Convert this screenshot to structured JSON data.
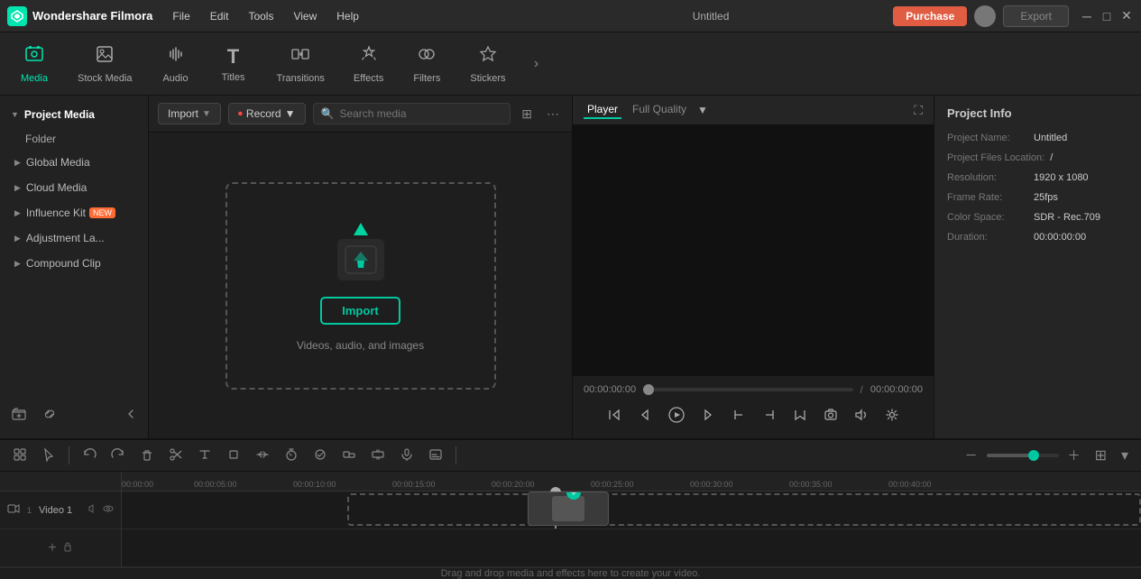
{
  "app": {
    "name": "Wondershare Filmora",
    "title": "Untitled"
  },
  "titlebar": {
    "menu_items": [
      "File",
      "Edit",
      "Tools",
      "View",
      "Help"
    ],
    "purchase_label": "Purchase",
    "export_label": "Export"
  },
  "toolbar": {
    "items": [
      {
        "id": "media",
        "label": "Media",
        "icon": "🎬"
      },
      {
        "id": "stock-media",
        "label": "Stock Media",
        "icon": "🎞"
      },
      {
        "id": "audio",
        "label": "Audio",
        "icon": "🎵"
      },
      {
        "id": "titles",
        "label": "Titles",
        "icon": "T"
      },
      {
        "id": "transitions",
        "label": "Transitions",
        "icon": "↔"
      },
      {
        "id": "effects",
        "label": "Effects",
        "icon": "✨"
      },
      {
        "id": "filters",
        "label": "Filters",
        "icon": "🎨"
      },
      {
        "id": "stickers",
        "label": "Stickers",
        "icon": "⭐"
      }
    ]
  },
  "sidebar": {
    "sections": [
      {
        "id": "project-media",
        "label": "Project Media",
        "active": true
      },
      {
        "id": "folder",
        "label": "Folder",
        "indent": true
      },
      {
        "id": "global-media",
        "label": "Global Media"
      },
      {
        "id": "cloud-media",
        "label": "Cloud Media"
      },
      {
        "id": "influence-kit",
        "label": "Influence Kit",
        "badge": "NEW"
      },
      {
        "id": "adjustment-la",
        "label": "Adjustment La..."
      },
      {
        "id": "compound-clip",
        "label": "Compound Clip"
      }
    ]
  },
  "media_panel": {
    "import_label": "Import",
    "record_label": "Record",
    "search_placeholder": "Search media",
    "drop_hint": "Videos, audio, and images",
    "import_btn_label": "Import"
  },
  "player": {
    "tabs": [
      "Player",
      "Full Quality"
    ],
    "time_current": "00:00:00:00",
    "time_separator": "/",
    "time_total": "00:00:00:00"
  },
  "project_info": {
    "title": "Project Info",
    "fields": [
      {
        "label": "Project Name:",
        "value": "Untitled"
      },
      {
        "label": "Project Files Location:",
        "value": "/"
      },
      {
        "label": "Resolution:",
        "value": "1920 x 1080"
      },
      {
        "label": "Frame Rate:",
        "value": "25fps"
      },
      {
        "label": "Color Space:",
        "value": "SDR - Rec.709"
      },
      {
        "label": "Duration:",
        "value": "00:00:00:00"
      }
    ]
  },
  "timeline": {
    "track_label": "Video 1",
    "ruler_marks": [
      "00:00:00",
      "00:00:05:00",
      "00:00:10:00",
      "00:00:15:00",
      "00:00:20:00",
      "00:00:25:00",
      "00:00:30:00",
      "00:00:35:00",
      "00:00:40:00"
    ],
    "drop_hint": "Drag and drop media and effects here to create your video."
  }
}
